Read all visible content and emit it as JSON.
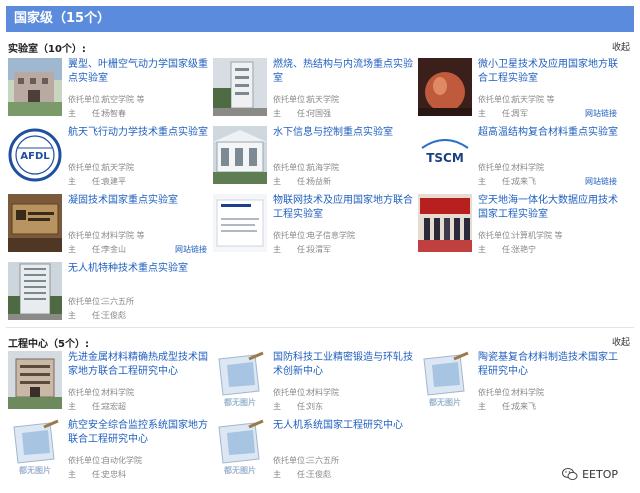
{
  "header": {
    "title": "国家级（15个）"
  },
  "labs": {
    "section_title": "实验室（10个）:",
    "collapse": "收起",
    "items": [
      {
        "title": "翼型、叶栅空气动力学国家级重点实验室",
        "unit_label": "依托单位：",
        "unit": "航空学院 等",
        "lead_label": "主　　任：",
        "lead": "杨智春",
        "link": ""
      },
      {
        "title": "燃烧、热结构与内流场重点实验室",
        "unit_label": "依托单位：",
        "unit": "航天学院",
        "lead_label": "主　　任：",
        "lead": "何国强",
        "link": ""
      },
      {
        "title": "微小卫星技术及应用国家地方联合工程实验室",
        "unit_label": "依托单位：",
        "unit": "航天学院 等",
        "lead_label": "主　　任：",
        "lead": "周军",
        "link": "网站链接"
      },
      {
        "title": "航天飞行动力学技术重点实验室",
        "unit_label": "依托单位：",
        "unit": "航天学院",
        "lead_label": "主　　任：",
        "lead": "袁建平",
        "link": ""
      },
      {
        "title": "水下信息与控制重点实验室",
        "unit_label": "依托单位：",
        "unit": "航海学院",
        "lead_label": "主　　任：",
        "lead": "杨益新",
        "link": ""
      },
      {
        "title": "超高温结构复合材料重点实验室",
        "unit_label": "依托单位：",
        "unit": "材料学院",
        "lead_label": "主　　任：",
        "lead": "成来飞",
        "link": "网站链接"
      },
      {
        "title": "凝固技术国家重点实验室",
        "unit_label": "依托单位：",
        "unit": "材料学院 等",
        "lead_label": "主　　任：",
        "lead": "李金山",
        "link": "网站链接"
      },
      {
        "title": "物联网技术及应用国家地方联合工程实验室",
        "unit_label": "依托单位：",
        "unit": "电子信息学院",
        "lead_label": "主　　任：",
        "lead": "段渭军",
        "link": ""
      },
      {
        "title": "空天地海一体化大数据应用技术国家工程实验室",
        "unit_label": "依托单位：",
        "unit": "计算机学院 等",
        "lead_label": "主　　任：",
        "lead": "张艳宁",
        "link": ""
      },
      {
        "title": "无人机特种技术重点实验室",
        "unit_label": "依托单位：",
        "unit": "三六五所",
        "lead_label": "主　　任：",
        "lead": "王俊彪",
        "link": ""
      }
    ]
  },
  "centers": {
    "section_title": "工程中心（5个）:",
    "collapse": "收起",
    "items": [
      {
        "title": "先进金属材料精确热成型技术国家地方联合工程研究中心",
        "unit_label": "依托单位：",
        "unit": "材料学院",
        "lead_label": "主　　任：",
        "lead": "寇宏超",
        "link": ""
      },
      {
        "title": "国防科技工业精密锻造与环轧技术创新中心",
        "unit_label": "依托单位：",
        "unit": "材料学院",
        "lead_label": "主　　任：",
        "lead": "刘东",
        "link": ""
      },
      {
        "title": "陶瓷基复合材料制造技术国家工程研究中心",
        "unit_label": "依托单位：",
        "unit": "材料学院",
        "lead_label": "主　　任：",
        "lead": "成来飞",
        "link": ""
      },
      {
        "title": "航空安全综合监控系统国家地方联合工程研究中心",
        "unit_label": "依托单位：",
        "unit": "自动化学院",
        "lead_label": "主　　任：",
        "lead": "史忠科",
        "link": ""
      },
      {
        "title": "无人机系统国家工程研究中心",
        "unit_label": "依托单位：",
        "unit": "三六五所",
        "lead_label": "主　　任：",
        "lead": "王俊彪",
        "link": ""
      }
    ]
  },
  "thumb_labels": {
    "afdl": "AFDL",
    "tscm": "TSCM",
    "placeholder": "都无图片"
  },
  "watermark": {
    "text": "EETOP"
  },
  "colors": {
    "header_bg": "#5b8bdc",
    "title_link": "#1f5fbf",
    "meta_text": "#888888"
  }
}
